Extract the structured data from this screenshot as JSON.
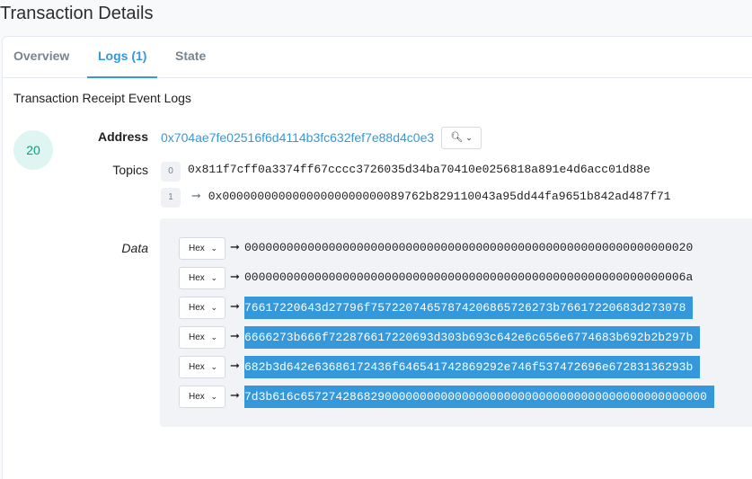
{
  "page": {
    "title": "Transaction Details"
  },
  "tabs": [
    {
      "label": "Overview"
    },
    {
      "label": "Logs (1)"
    },
    {
      "label": "State"
    }
  ],
  "logs": {
    "heading": "Transaction Receipt Event Logs",
    "log_index": "20",
    "address_label": "Address",
    "address": "0x704ae7fe02516f6d4114b3fc632fef7e88d4c0e3",
    "address_button": "🔍︎ ⌄",
    "topics_label": "Topics",
    "topics": [
      {
        "index": "0",
        "value": "0x811f7cff0a3374ff67cccc3726035d34ba70410e0256818a891e4d6acc01d88e"
      },
      {
        "index": "1",
        "value": "0x00000000000000000000000089762b829110043a95dd44fa9651b842ad487f71"
      }
    ],
    "data_label": "Data",
    "data": [
      {
        "format": "Hex",
        "value": "0000000000000000000000000000000000000000000000000000000000000020"
      },
      {
        "format": "Hex",
        "value": "000000000000000000000000000000000000000000000000000000000000006a"
      },
      {
        "format": "Hex",
        "value": "76617220643d27796f75722074657874206865726273b76617220683d273078"
      },
      {
        "format": "Hex",
        "value": "6666273b666f722876617220693d303b693c642e6c656e6774683b692b2b297b"
      },
      {
        "format": "Hex",
        "value": "682b3d642e63686172436f646541742869292e746f537472696e67283136293b"
      },
      {
        "format": "Hex",
        "value": "7d3b616c6572742868290000000000000000000000000000000000000000000000"
      }
    ]
  }
}
